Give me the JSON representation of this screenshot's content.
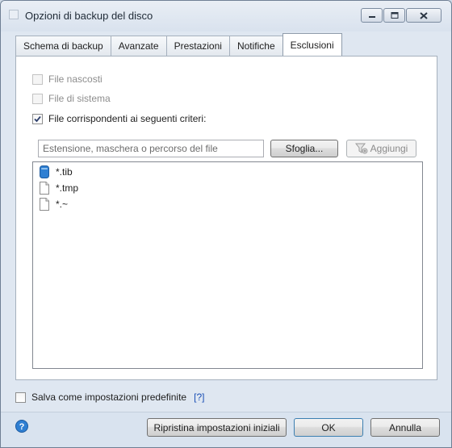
{
  "window": {
    "title": "Opzioni di backup del disco"
  },
  "tabs": [
    {
      "label": "Schema di backup",
      "active": false
    },
    {
      "label": "Avanzate",
      "active": false
    },
    {
      "label": "Prestazioni",
      "active": false
    },
    {
      "label": "Notifiche",
      "active": false
    },
    {
      "label": "Esclusioni",
      "active": true
    }
  ],
  "exclusions": {
    "hidden_files": {
      "label": "File nascosti",
      "checked": false,
      "enabled": false
    },
    "system_files": {
      "label": "File di sistema",
      "checked": false,
      "enabled": false
    },
    "matching_files": {
      "label": "File corrispondenti ai seguenti criteri:",
      "checked": true,
      "enabled": true
    },
    "criteria_input": {
      "placeholder": "Estensione, maschera o percorso del file",
      "value": ""
    },
    "browse_label": "Sfoglia...",
    "add_label": "Aggiungi",
    "items": [
      {
        "text": "*.tib",
        "icon": "tib-file-icon"
      },
      {
        "text": "*.tmp",
        "icon": "document-icon"
      },
      {
        "text": "*.~",
        "icon": "document-icon"
      }
    ]
  },
  "footer": {
    "save_default_label": "Salva come impostazioni predefinite",
    "help_link": "[?]",
    "reset_label": "Ripristina impostazioni iniziali",
    "ok_label": "OK",
    "cancel_label": "Annulla"
  },
  "colors": {
    "accent": "#2f7fd2",
    "link": "#1a4fb5"
  }
}
